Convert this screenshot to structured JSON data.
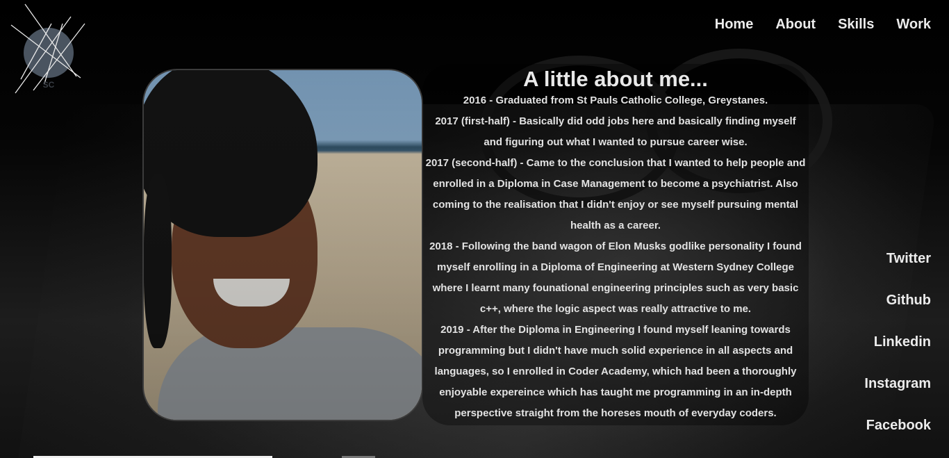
{
  "logo": {
    "initials": "SC"
  },
  "nav": {
    "items": [
      {
        "label": "Home"
      },
      {
        "label": "About"
      },
      {
        "label": "Skills"
      },
      {
        "label": "Work"
      }
    ]
  },
  "about": {
    "title": "A little about me...",
    "paragraphs": [
      "2016 - Graduated from St Pauls Catholic College, Greystanes.",
      "2017 (first-half) - Basically did odd jobs here and basically finding myself and figuring out what I wanted to pursue career wise.",
      "2017 (second-half) - Came to the conclusion that I wanted to help people and enrolled in a Diploma in Case Management to become a psychiatrist. Also coming to the realisation that I didn't enjoy or see myself pursuing mental health as a career.",
      "2018 - Following the band wagon of Elon Musks godlike personality I found myself enrolling in a Diploma of Engineering at Western Sydney College where I learnt many founational engineering principles such as very basic c++, where the logic aspect was really attractive to me.",
      "2019 - After the Diploma in Engineering I found myself leaning towards programming but I didn't have much solid experience in all aspects and languages, so I enrolled in Coder Academy, which had been a thoroughly enjoyable expereince which has taught me programming in an in-depth perspective straight from the horeses mouth of everyday coders."
    ]
  },
  "social": {
    "items": [
      {
        "label": "Twitter"
      },
      {
        "label": "Github"
      },
      {
        "label": "Linkedin"
      },
      {
        "label": "Instagram"
      },
      {
        "label": "Facebook"
      }
    ]
  },
  "colors": {
    "background": "#000000",
    "text": "#e6e6e6",
    "logo_circle": "#4a5460"
  },
  "icons": {
    "logo": "sc-monogram-icon"
  }
}
